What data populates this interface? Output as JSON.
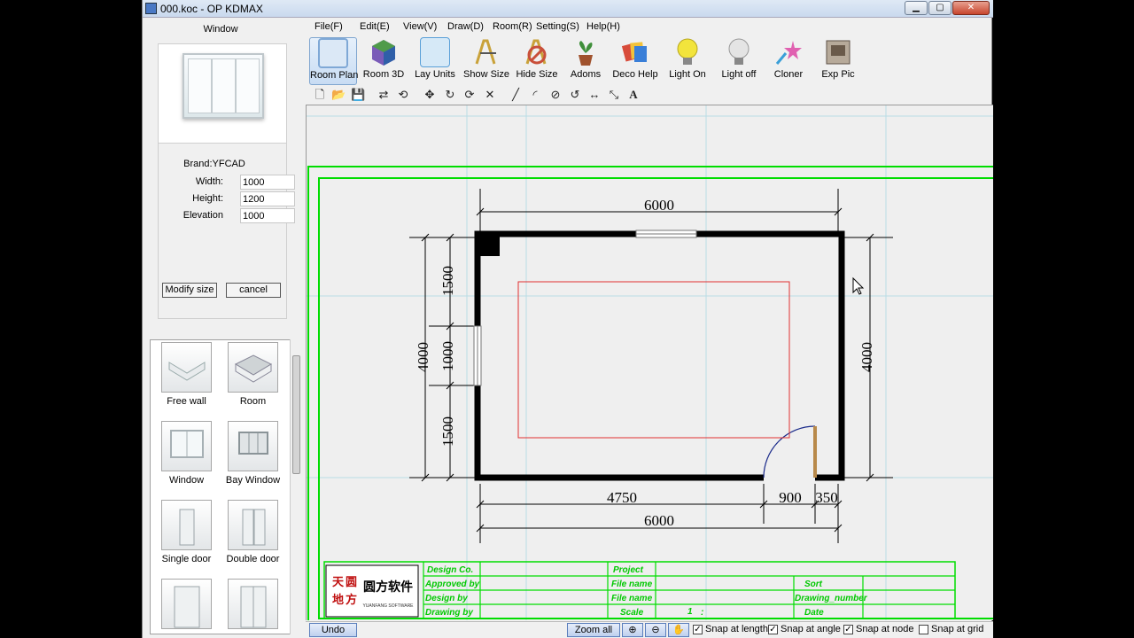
{
  "window": {
    "title": "000.koc - OP KDMAX",
    "min": "▁",
    "max": "▢",
    "close": "✕"
  },
  "side_panel": {
    "title": "Window",
    "brand": "Brand:YFCAD",
    "fields": [
      {
        "label": "Width:",
        "value": "1000"
      },
      {
        "label": "Height:",
        "value": "1200"
      },
      {
        "label": "Elevation",
        "value": "1000"
      }
    ],
    "modify_label": "Modify size",
    "cancel_label": "cancel"
  },
  "library": [
    {
      "label": "Free wall",
      "icon": "free-wall-icon"
    },
    {
      "label": "Room",
      "icon": "room-icon"
    },
    {
      "label": "Window",
      "icon": "window-icon"
    },
    {
      "label": "Bay Window",
      "icon": "bay-window-icon"
    },
    {
      "label": "Single door",
      "icon": "single-door-icon"
    },
    {
      "label": "Double door",
      "icon": "double-door-icon"
    },
    {
      "label": "",
      "icon": "door-icon"
    },
    {
      "label": "",
      "icon": "door-icon"
    }
  ],
  "menu": [
    "File(F)",
    "Edit(E)",
    "View(V)",
    "Draw(D)",
    "Room(R)",
    "Setting(S)",
    "Help(H)"
  ],
  "toolbar": [
    {
      "label": "Room Plan",
      "icon": "room-plan-icon",
      "color": "#7fa8d6"
    },
    {
      "label": "Room 3D",
      "icon": "cube-icon",
      "color": "#7a5bb8"
    },
    {
      "label": "Lay Units",
      "icon": "lay-units-icon",
      "color": "#5aa0d8"
    },
    {
      "label": "Show Size",
      "icon": "show-size-icon",
      "color": "#c9a23a"
    },
    {
      "label": "Hide Size",
      "icon": "hide-size-icon",
      "color": "#c94f3a"
    },
    {
      "label": "Adoms",
      "icon": "plant-icon",
      "color": "#3f8f3a"
    },
    {
      "label": "Deco Help",
      "icon": "deco-help-icon",
      "color": "#d84b3a"
    },
    {
      "label": "Light On",
      "icon": "bulb-on-icon",
      "color": "#f2e43c"
    },
    {
      "label": "Light off",
      "icon": "bulb-off-icon",
      "color": "#c8c8c8"
    },
    {
      "label": "Cloner",
      "icon": "cloner-icon",
      "color": "#e060b0"
    },
    {
      "label": "Exp Pic",
      "icon": "export-picture-icon",
      "color": "#8a7a6a"
    }
  ],
  "small_tools": [
    {
      "name": "new-file-icon",
      "glyph": "🗋"
    },
    {
      "name": "open-folder-icon",
      "glyph": "📂"
    },
    {
      "name": "save-icon",
      "glyph": "💾"
    },
    {
      "name": "mirror-icon",
      "glyph": "⇄"
    },
    {
      "name": "rotate-mirror-icon",
      "glyph": "⟲"
    },
    {
      "name": "move-icon",
      "glyph": "✥"
    },
    {
      "name": "rotate-icon",
      "glyph": "↻"
    },
    {
      "name": "copy-rotate-icon",
      "glyph": "⟳"
    },
    {
      "name": "delete-icon",
      "glyph": "✕"
    },
    {
      "name": "line-icon",
      "glyph": "╱"
    },
    {
      "name": "arc-icon",
      "glyph": "◜"
    },
    {
      "name": "circle-icon",
      "glyph": "⊘"
    },
    {
      "name": "rotate-arc-icon",
      "glyph": "↺"
    },
    {
      "name": "dimension-icon",
      "glyph": "↔"
    },
    {
      "name": "node-icon",
      "glyph": "⤡"
    },
    {
      "name": "text-icon",
      "glyph": "A"
    }
  ],
  "plan": {
    "top_dim": "6000",
    "bottom_dim": "6000",
    "left_dim": "4000",
    "right_dim": "4000",
    "left_segments": [
      "1500",
      "1000",
      "1500"
    ],
    "bottom_segments": [
      "4750",
      "900",
      "350"
    ],
    "title_block": {
      "logo_text": "圆方软件",
      "logo_sub": "YUANFANG SOFTWARE",
      "logo_chars": [
        "天",
        "圆",
        "地",
        "方"
      ],
      "left_rows": [
        "Design Co.",
        "Approved by",
        "Design by",
        "Drawing by"
      ],
      "mid_rows": [
        "Project",
        "File name",
        "File name",
        "Scale"
      ],
      "right_rows": [
        "Sort",
        "Drawing_number",
        "Date"
      ],
      "scale_value": "1",
      "scale_sep": ":"
    }
  },
  "status": {
    "undo": "Undo",
    "zoom_all": "Zoom all",
    "zoom_in_icon": "zoom-in-icon",
    "zoom_out_icon": "zoom-out-icon",
    "pan_icon": "pan-hand-icon",
    "snaps": [
      {
        "label": "Snap at length",
        "checked": true
      },
      {
        "label": "Snap at angle",
        "checked": true
      },
      {
        "label": "Snap at node",
        "checked": true
      },
      {
        "label": "Snap at grid",
        "checked": false
      }
    ]
  },
  "colors": {
    "green": "#00dd00",
    "red": "#e03030",
    "grid": "#b8dce6",
    "wall": "#000000",
    "door_arc": "#1a2a8a",
    "door_leaf": "#b8894a"
  }
}
